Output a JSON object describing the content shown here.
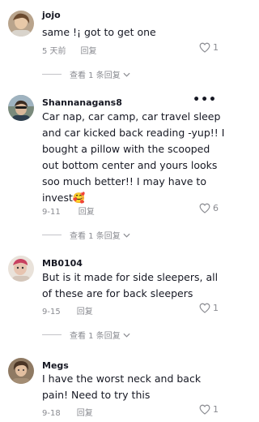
{
  "comments": [
    {
      "username": "jojo",
      "text": "same !¡ got to get one",
      "date": "5 天前",
      "reply": "回复",
      "likes": "1",
      "icons": {
        "like": "heart-outline-icon"
      }
    },
    {
      "username": "Shannanagans8",
      "text": "Car nap, car camp, car travel sleep and car kicked back reading -yup!! I bought a pillow with the scooped out bottom center and yours looks soo much better!! I may have to invest🥰",
      "date": "9-11",
      "reply": "回复",
      "likes": "6",
      "view_replies": "查看 1 条回复",
      "icons": {
        "more": "more-dots-icon",
        "like": "heart-outline-icon"
      }
    },
    {
      "username": "MB0104",
      "text": "But is it made for side sleepers, all of these are for back sleepers",
      "date": "9-15",
      "reply": "回复",
      "likes": "1",
      "view_replies": "查看 1 条回复",
      "icons": {
        "like": "heart-outline-icon"
      }
    },
    {
      "username": "Megs",
      "text": "I have the worst neck and back pain! Need to try this",
      "date": "9-18",
      "reply": "回复",
      "likes": "1",
      "icons": {
        "like": "heart-outline-icon"
      }
    }
  ],
  "top_view_replies": "查看 1 条回复",
  "colors": {
    "text": "#161823",
    "muted": "#8a8b91"
  }
}
